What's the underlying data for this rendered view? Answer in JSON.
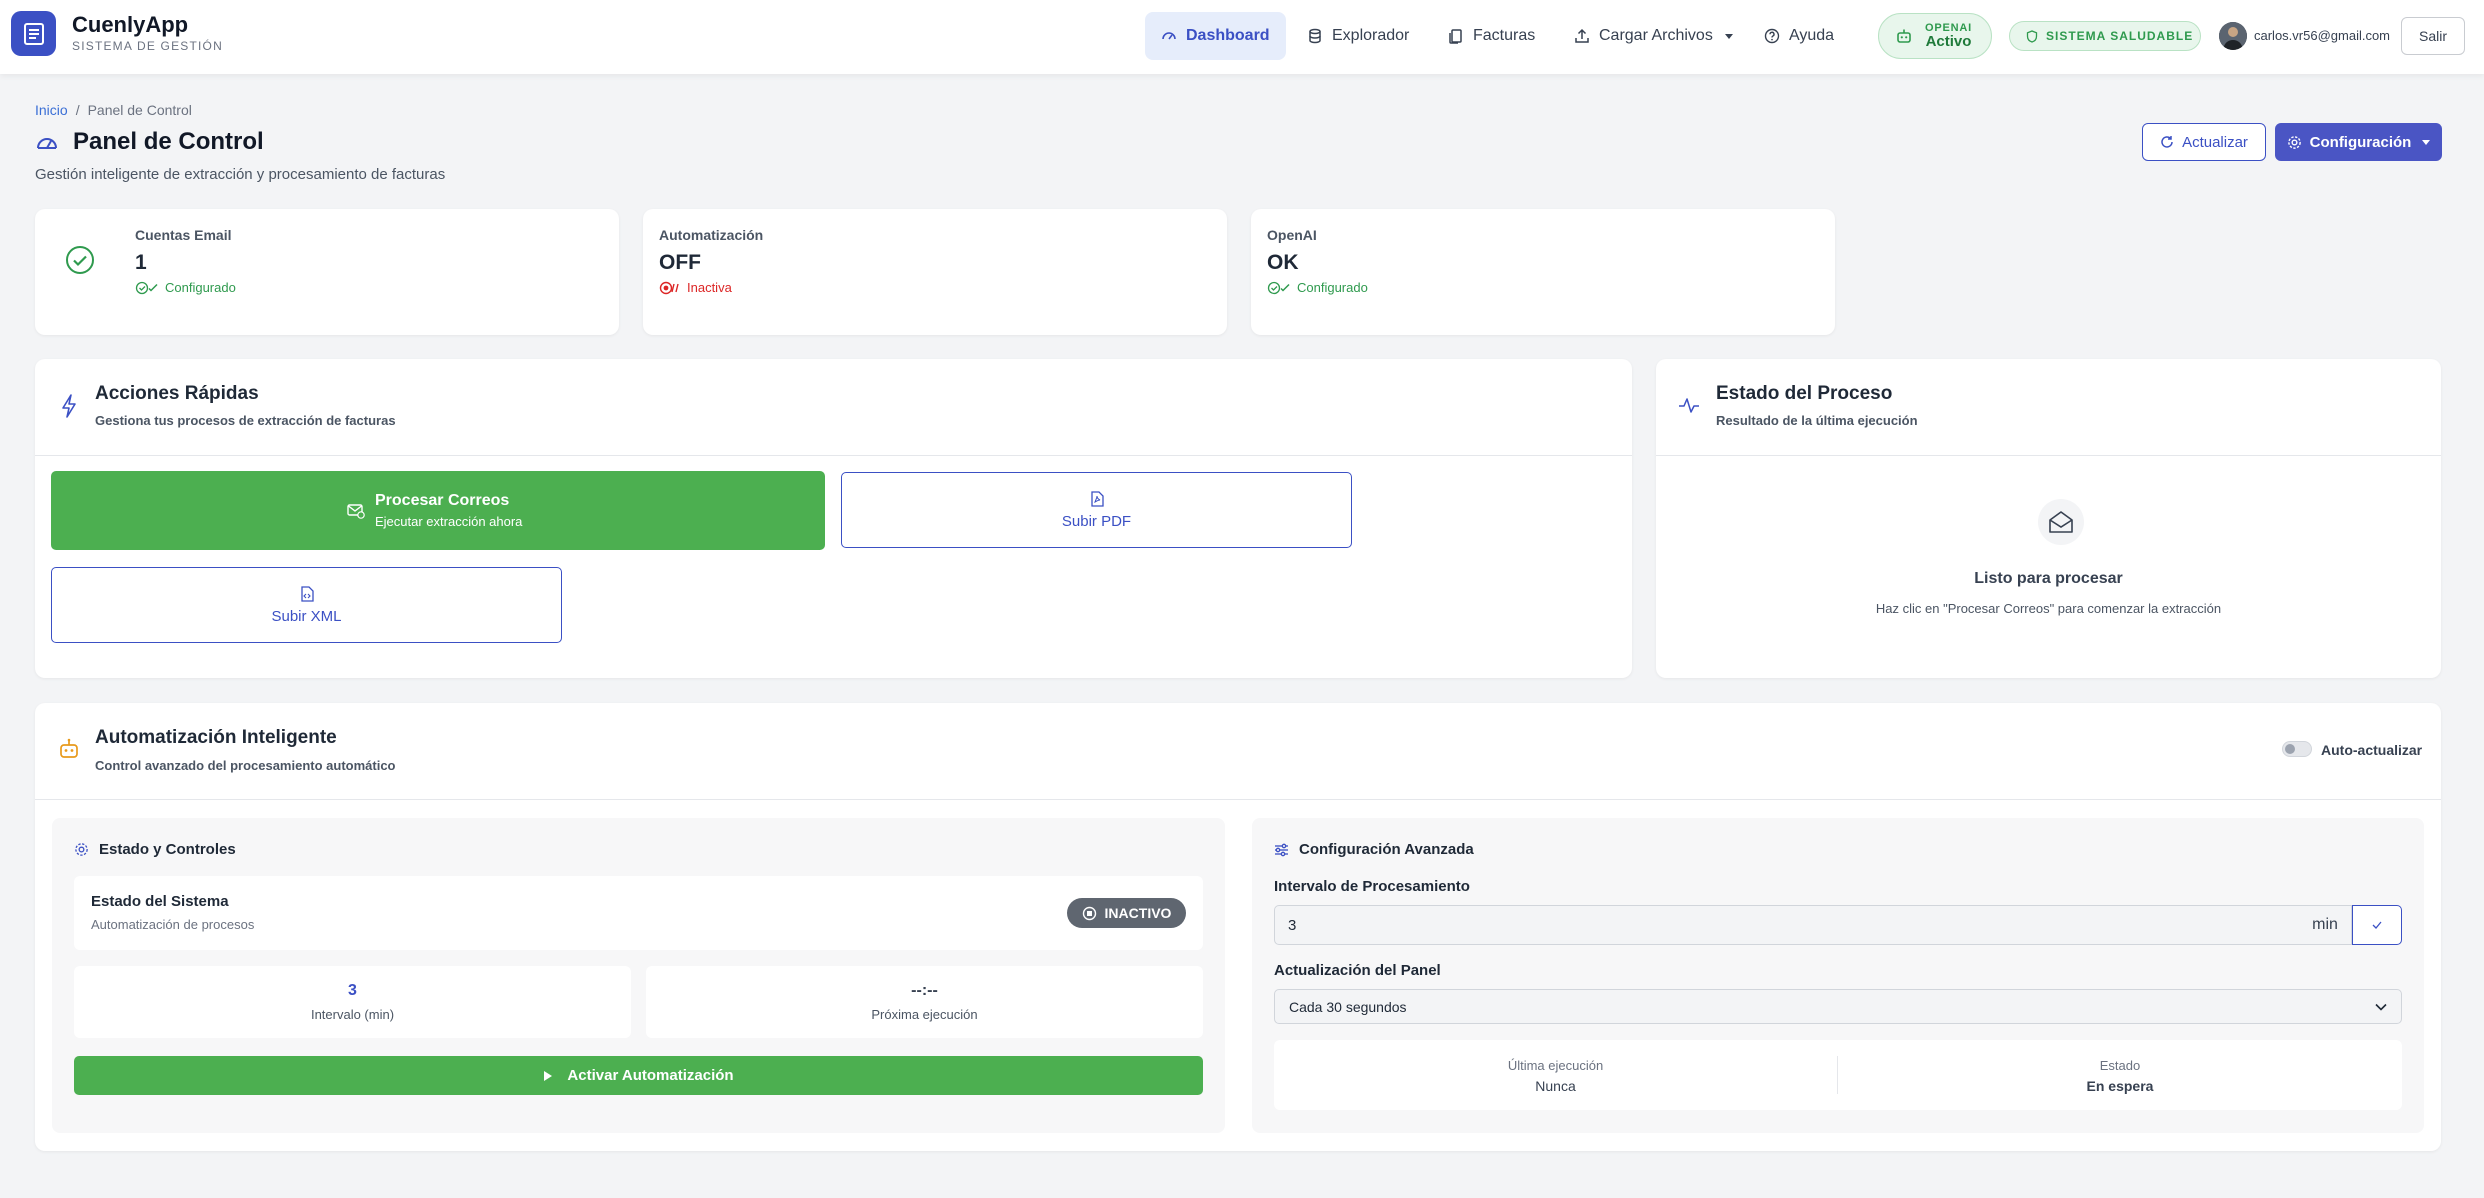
{
  "app": {
    "name": "CuenlyApp",
    "subtitle": "SISTEMA DE GESTIÓN"
  },
  "nav": {
    "dashboard": "Dashboard",
    "explorer": "Explorador",
    "invoices": "Facturas",
    "upload": "Cargar Archivos",
    "help": "Ayuda"
  },
  "status": {
    "openai_label": "OPENAI",
    "openai_value": "Activo",
    "system": "SISTEMA SALUDABLE"
  },
  "user": {
    "email": "carlos.vr56@gmail.com",
    "logout": "Salir"
  },
  "breadcrumb": {
    "home": "Inicio",
    "current": "Panel de Control"
  },
  "page": {
    "title": "Panel de Control",
    "subtitle": "Gestión inteligente de extracción y procesamiento de facturas",
    "refresh": "Actualizar",
    "config": "Configuración"
  },
  "stats": [
    {
      "label": "Cuentas Email",
      "value": "1",
      "status": "Configurado"
    },
    {
      "label": "Automatización",
      "value": "OFF",
      "status": "Inactiva"
    },
    {
      "label": "OpenAI",
      "value": "OK",
      "status": "Configurado"
    }
  ],
  "quick_actions": {
    "title": "Acciones Rápidas",
    "subtitle": "Gestiona tus procesos de extracción de facturas",
    "process_title": "Procesar Correos",
    "process_sub": "Ejecutar extracción ahora",
    "upload_pdf": "Subir PDF",
    "upload_xml": "Subir XML"
  },
  "process_status": {
    "title": "Estado del Proceso",
    "subtitle": "Resultado de la última ejecución",
    "empty_title": "Listo para procesar",
    "empty_sub": "Haz clic en \"Procesar Correos\" para comenzar la extracción"
  },
  "automation": {
    "title": "Automatización Inteligente",
    "subtitle": "Control avanzado del procesamiento automático",
    "auto_refresh": "Auto-actualizar",
    "controls_title": "Estado y Controles",
    "system_state": "Estado del Sistema",
    "system_state_sub": "Automatización de procesos",
    "badge": "INACTIVO",
    "interval_value": "3",
    "interval_label": "Intervalo (min)",
    "next_value": "--:--",
    "next_label": "Próxima ejecución",
    "activate": "Activar Automatización",
    "advanced_title": "Configuración Avanzada",
    "interval_field_label": "Intervalo de Procesamiento",
    "interval_input": "3",
    "interval_unit": "min",
    "panel_refresh_label": "Actualización del Panel",
    "panel_refresh_value": "Cada 30 segundos",
    "last_run_label": "Última ejecución",
    "last_run_value": "Nunca",
    "state_label": "Estado",
    "state_value": "En espera"
  },
  "colors": {
    "primary": "#3b50c4",
    "success": "#4caf50",
    "danger": "#dc2626"
  }
}
